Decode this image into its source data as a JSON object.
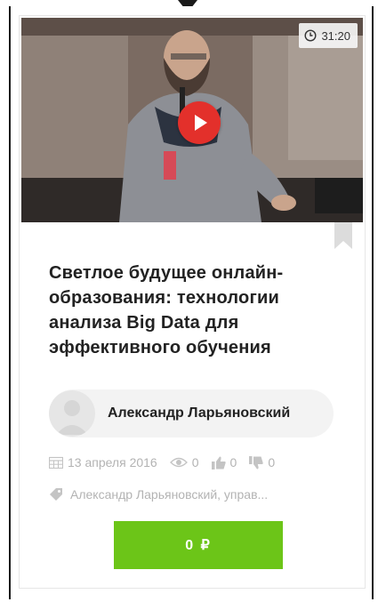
{
  "video": {
    "duration": "31:20"
  },
  "course": {
    "title_line1": "Светлое будущее онлайн-",
    "title_line2": "образования: технологии",
    "title_line3": "анализа Big Data для",
    "title_line4": "эффективного обучения"
  },
  "author": {
    "name": "Александр Ларьяновский"
  },
  "meta": {
    "date": "13 апреля 2016",
    "views": "0",
    "likes": "0",
    "dislikes": "0"
  },
  "tags": {
    "text": "Александр Ларьяновский, управ..."
  },
  "price": {
    "label": "0 ₽"
  },
  "colors": {
    "play": "#e3302b",
    "buy_button": "#6cc518",
    "muted_text": "#b3b3b3"
  }
}
